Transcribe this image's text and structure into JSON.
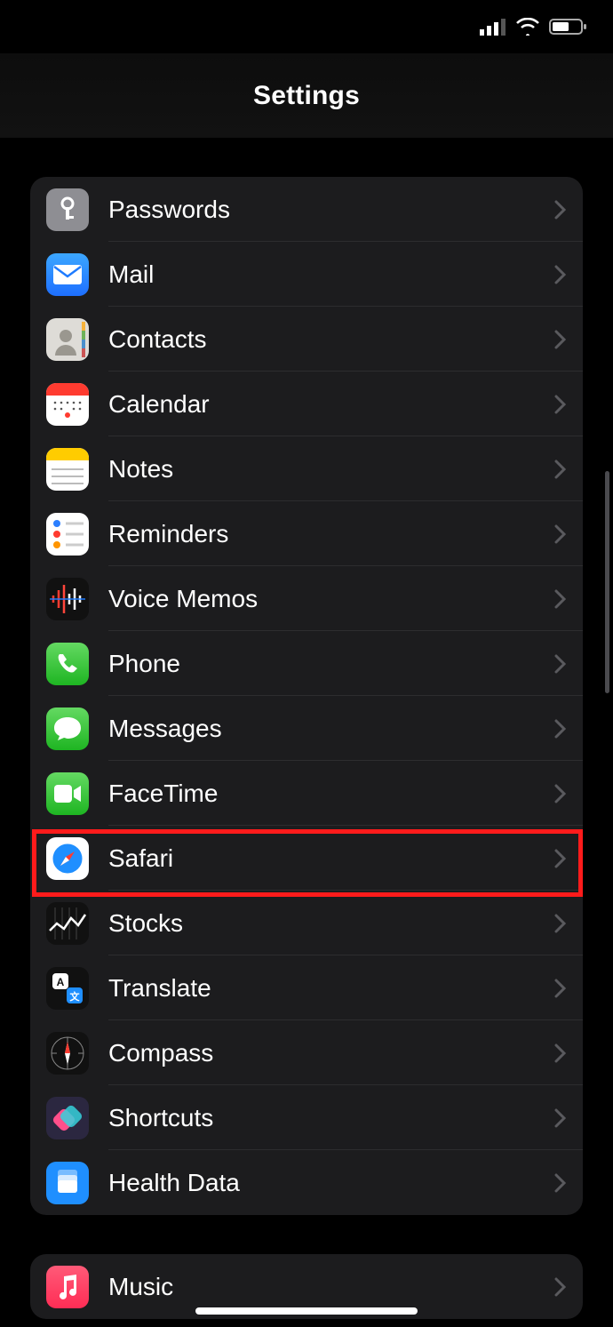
{
  "page_title": "Settings",
  "group1": [
    {
      "key": "passwords",
      "label": "Passwords"
    },
    {
      "key": "mail",
      "label": "Mail"
    },
    {
      "key": "contacts",
      "label": "Contacts"
    },
    {
      "key": "calendar",
      "label": "Calendar"
    },
    {
      "key": "notes",
      "label": "Notes"
    },
    {
      "key": "reminders",
      "label": "Reminders"
    },
    {
      "key": "voicememos",
      "label": "Voice Memos"
    },
    {
      "key": "phone",
      "label": "Phone"
    },
    {
      "key": "messages",
      "label": "Messages"
    },
    {
      "key": "facetime",
      "label": "FaceTime"
    },
    {
      "key": "safari",
      "label": "Safari"
    },
    {
      "key": "stocks",
      "label": "Stocks"
    },
    {
      "key": "translate",
      "label": "Translate"
    },
    {
      "key": "compass",
      "label": "Compass"
    },
    {
      "key": "shortcuts",
      "label": "Shortcuts"
    },
    {
      "key": "healthdata",
      "label": "Health Data"
    }
  ],
  "group2": [
    {
      "key": "music",
      "label": "Music"
    }
  ],
  "highlighted_row": "safari"
}
